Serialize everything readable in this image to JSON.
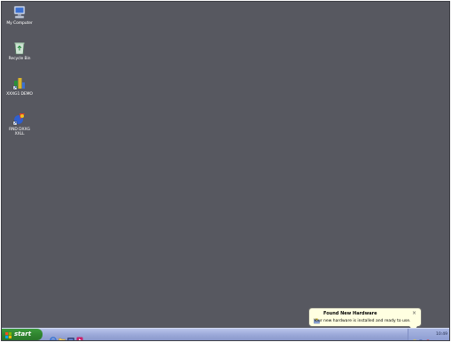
{
  "desktop": {
    "background_color": "#575860",
    "icons": [
      {
        "label": "My Computer",
        "icon": "my-computer-icon"
      },
      {
        "label": "Recycle Bin",
        "icon": "recycle-bin-icon"
      },
      {
        "label": "XXXG1 DEMO",
        "icon": "program-shortcut-icon"
      },
      {
        "label": "RND DXXG\nXXLL",
        "icon": "application-shortcut-icon"
      }
    ]
  },
  "taskbar": {
    "start_label": "start",
    "quick_launch": [
      "internet-explorer-icon",
      "folder-icon",
      "show-desktop-icon",
      "media-player-icon"
    ],
    "tray_icons": [
      "hardware-icon",
      "network-icon",
      "security-icon"
    ],
    "clock": "10:49"
  },
  "notification": {
    "title": "Found New Hardware",
    "message": "Your new hardware is installed and ready to use.",
    "close": "×"
  }
}
